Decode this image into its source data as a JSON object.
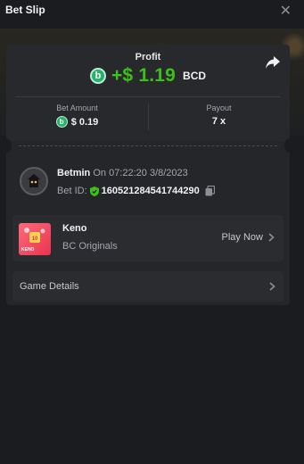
{
  "header": {
    "title": "Bet Slip",
    "close_icon": "✕"
  },
  "profit": {
    "label": "Profit",
    "value": "+$ 1.19",
    "currency": "BCD",
    "coin_letter": "b"
  },
  "bet_amount": {
    "label": "Bet Amount",
    "value": "$ 0.19"
  },
  "payout": {
    "label": "Payout",
    "value": "7 x"
  },
  "user": {
    "name": "Betmin",
    "on_text": "On 07:22:20 3/8/2023",
    "bet_id_label": "Bet ID:",
    "bet_id": "160521284541744290"
  },
  "game": {
    "name": "Keno",
    "provider": "BC Originals",
    "play_label": "Play Now",
    "thumb_text": "KENO"
  },
  "details": {
    "label": "Game Details"
  },
  "colors": {
    "accent_green": "#3bc117",
    "coin_green": "#23b36b",
    "keno_red": "#ff6a7b"
  }
}
